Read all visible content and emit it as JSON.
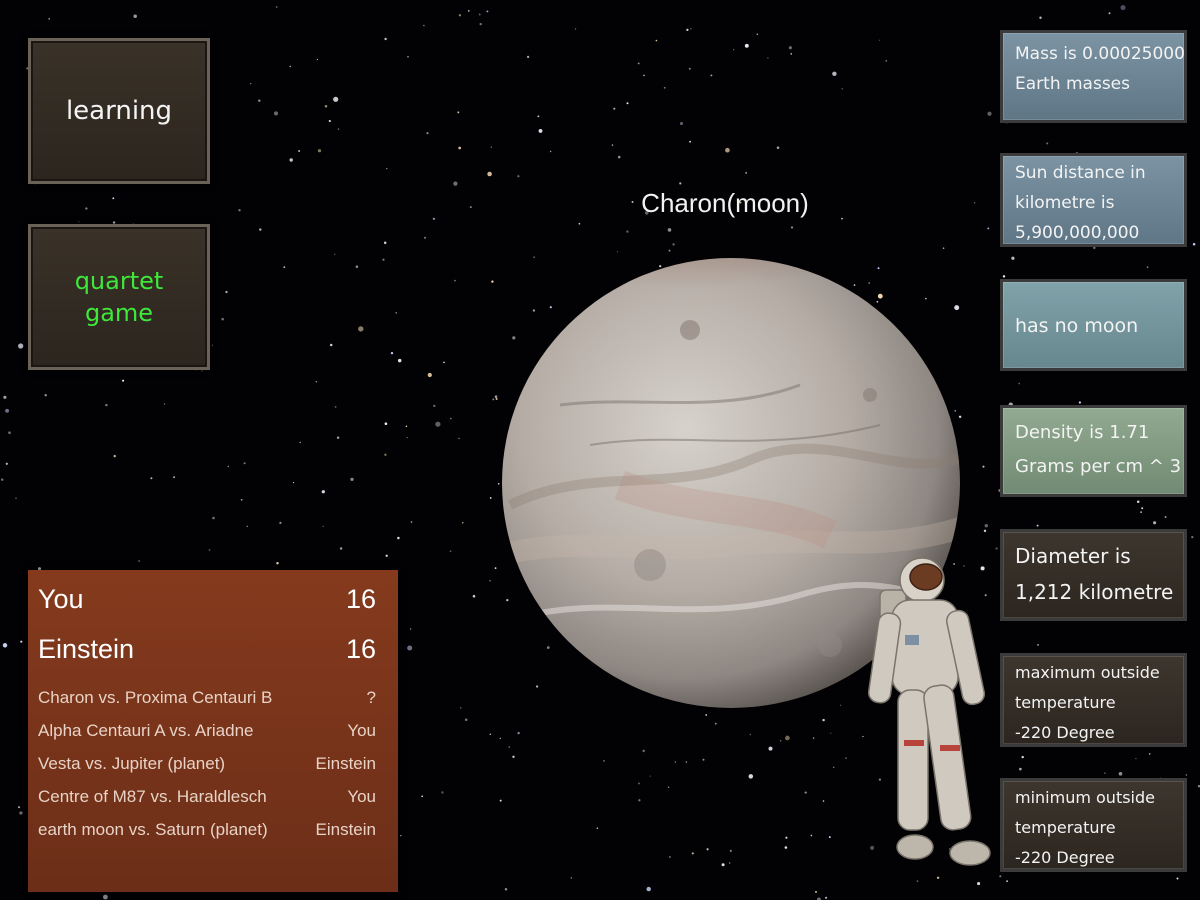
{
  "menu": {
    "learning_label": "learning",
    "quartet_label": "quartet game"
  },
  "planet": {
    "title": "Charon(moon)"
  },
  "stats": [
    {
      "line1": "Mass is 0.00025000",
      "line2": "Earth masses",
      "line3": ""
    },
    {
      "line1": "Sun distance in",
      "line2": "kilometre is",
      "line3": "5,900,000,000"
    },
    {
      "line1": "has no moon",
      "line2": "",
      "line3": ""
    },
    {
      "line1": "Density is 1.71",
      "line2": "Grams per cm ^ 3",
      "line3": ""
    },
    {
      "line1": "Diameter is",
      "line2": "1,212 kilometre",
      "line3": ""
    },
    {
      "line1": "maximum outside",
      "line2": "temperature",
      "line3": "-220 Degree"
    },
    {
      "line1": "minimum outside",
      "line2": "temperature",
      "line3": "-220 Degree"
    }
  ],
  "scoreboard": {
    "players": [
      {
        "name": "You",
        "score": "16"
      },
      {
        "name": "Einstein",
        "score": "16"
      }
    ],
    "matches": [
      {
        "matchup": "Charon vs. Proxima Centauri B",
        "winner": "?"
      },
      {
        "matchup": "Alpha Centauri A vs. Ariadne",
        "winner": "You"
      },
      {
        "matchup": "Vesta vs. Jupiter (planet)",
        "winner": "Einstein"
      },
      {
        "matchup": "Centre of M87 vs. Haraldlesch",
        "winner": "You"
      },
      {
        "matchup": "earth moon vs. Saturn (planet)",
        "winner": "Einstein"
      }
    ]
  },
  "colors": {
    "quartet_text": "#3ee83a",
    "score_panel": "#853a1d"
  }
}
